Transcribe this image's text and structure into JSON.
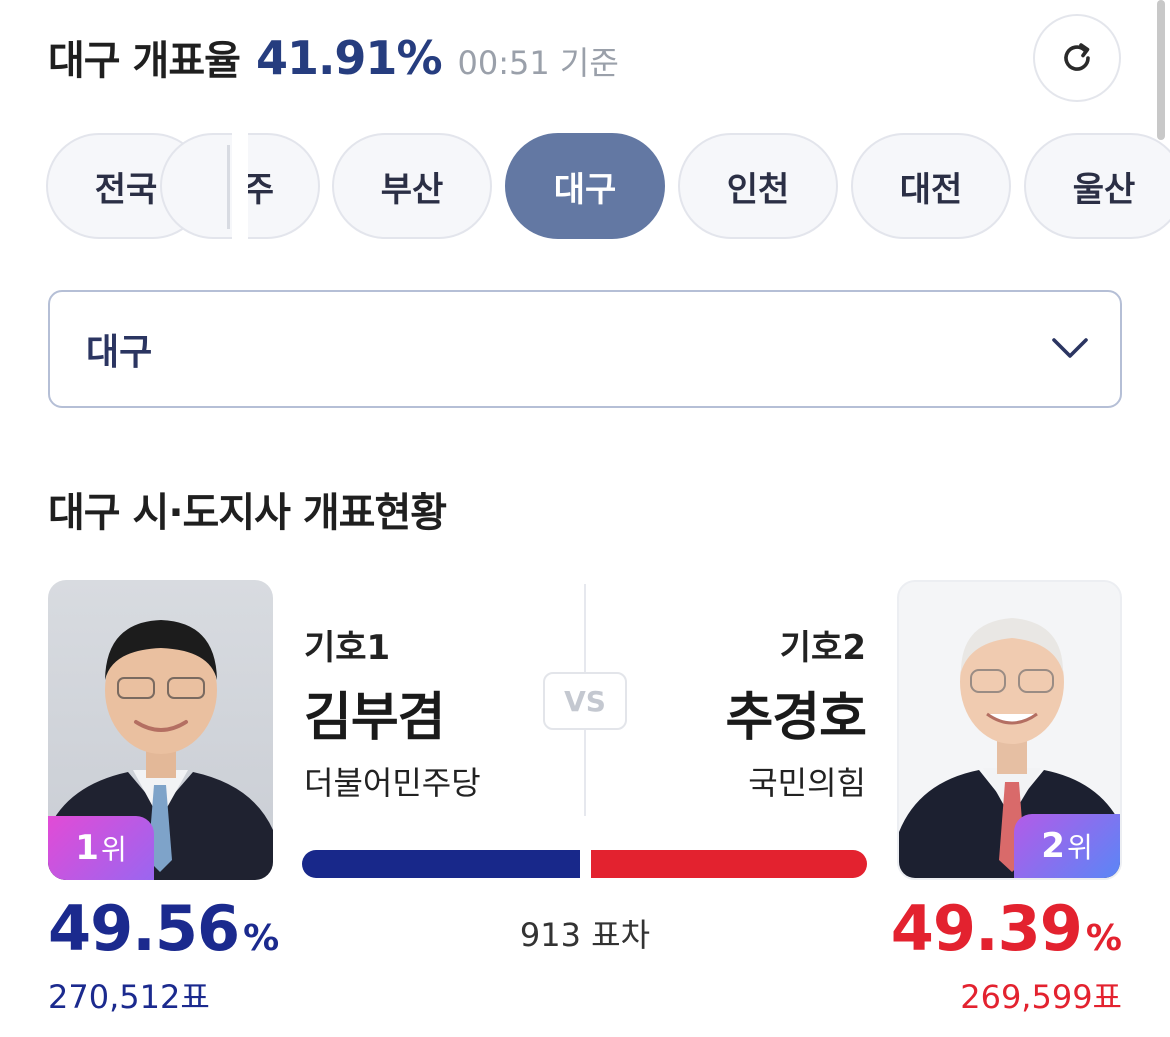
{
  "header": {
    "title": "대구 개표율",
    "rate": "41.91%",
    "time": "00:51 기준",
    "refresh_icon": "refresh-icon"
  },
  "tabs": [
    {
      "label": "전국",
      "active": false
    },
    {
      "label": "주",
      "active": false
    },
    {
      "label": "부산",
      "active": false
    },
    {
      "label": "대구",
      "active": true
    },
    {
      "label": "인천",
      "active": false
    },
    {
      "label": "대전",
      "active": false
    },
    {
      "label": "울산",
      "active": false
    }
  ],
  "select": {
    "value": "대구",
    "icon": "chevron-down-icon"
  },
  "section_title": "대구 시·도지사 개표현황",
  "vs_label": "VS",
  "gap_text": "913 표차",
  "candidates": {
    "left": {
      "number": "기호1",
      "name": "김부겸",
      "party": "더불어민주당",
      "rank": "1",
      "rank_suffix": "위",
      "percent": "49.56",
      "percent_sign": "%",
      "votes": "270,512표",
      "share": 49.56,
      "color": "#18288a"
    },
    "right": {
      "number": "기호2",
      "name": "추경호",
      "party": "국민의힘",
      "rank": "2",
      "rank_suffix": "위",
      "percent": "49.39",
      "percent_sign": "%",
      "votes": "269,599표",
      "share": 49.39,
      "color": "#e3222f"
    }
  },
  "colors": {
    "accent": "#263d7f",
    "active_tab": "#6378a3",
    "blue": "#18288a",
    "red": "#e3222f"
  }
}
